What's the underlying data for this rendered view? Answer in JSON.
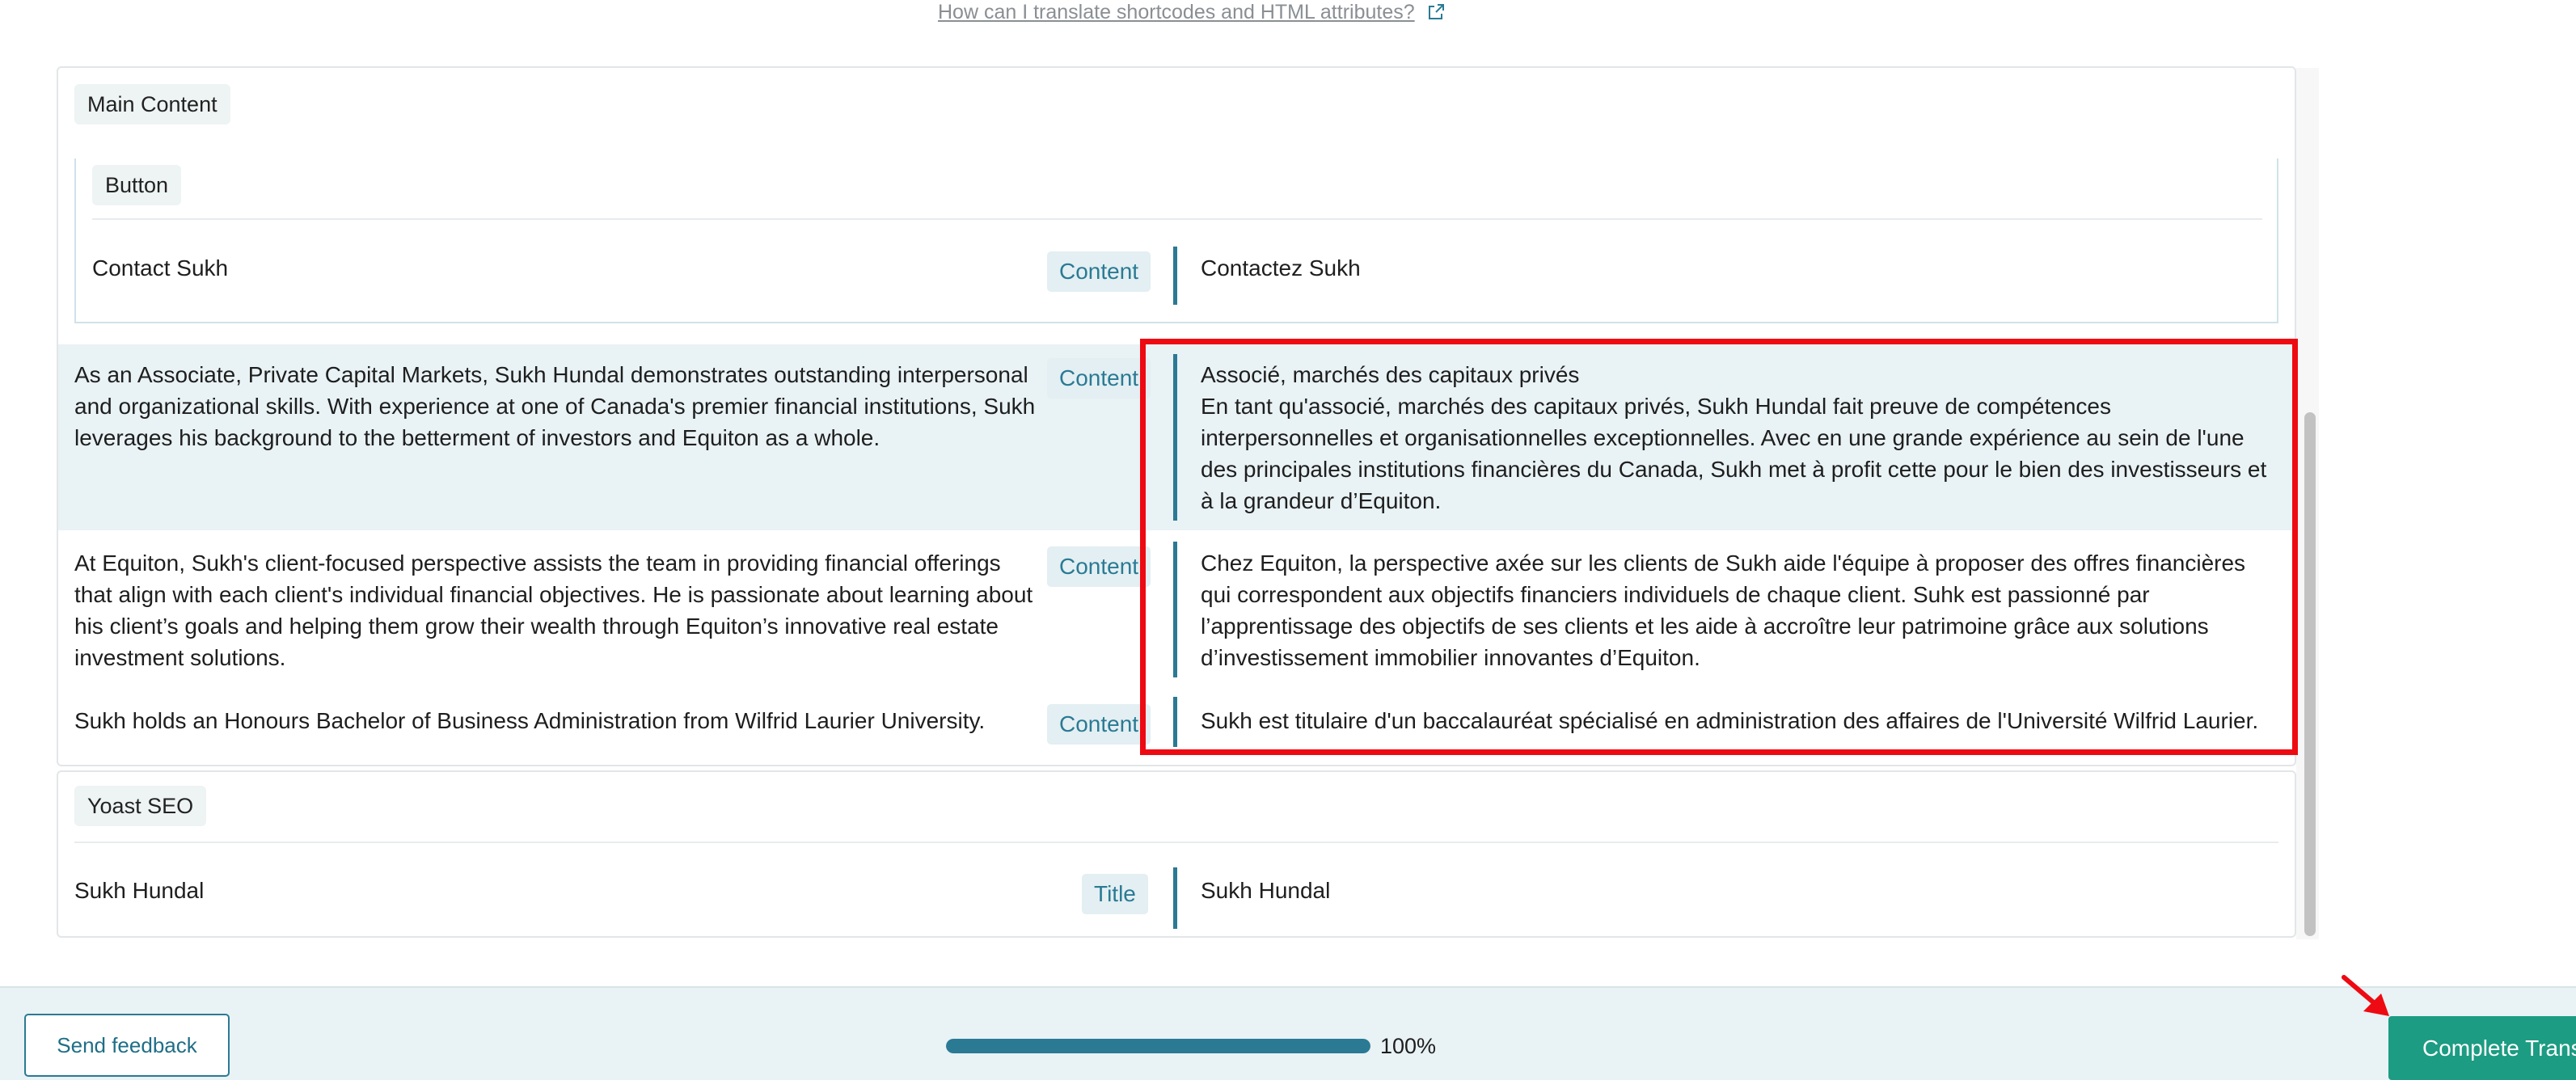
{
  "help": {
    "link_text": "How can I translate shortcodes and HTML attributes?"
  },
  "main_content": {
    "title": "Main Content",
    "button_group": {
      "title": "Button",
      "source": "Contact Sukh",
      "badge": "Content",
      "translation": "Contactez Sukh"
    },
    "rows": [
      {
        "source": "As an Associate, Private Capital Markets, Sukh Hundal demonstrates outstanding interpersonal and organizational skills. With experience at one of Canada's premier financial institutions, Sukh leverages his background to the betterment of investors and Equiton as a whole.",
        "badge": "Content",
        "translation_line1": "Associé, marchés des capitaux privés",
        "translation": "En tant qu'associé, marchés des capitaux privés, Sukh Hundal fait preuve de compétences interpersonnelles et organisationnelles exceptionnelles. Avec en une grande expérience au sein de l'une des principales institutions financières du Canada, Sukh met à profit cette pour le bien des investisseurs et à la grandeur d’Equiton."
      },
      {
        "source": "At Equiton, Sukh's client-focused perspective assists the team in providing financial offerings that align with each client's individual financial objectives. He is passionate about learning about his client’s goals and helping them grow their wealth through Equiton’s innovative real estate investment solutions.",
        "badge": "Content",
        "translation": "Chez Equiton, la perspective axée sur les clients de Sukh aide l'équipe à proposer des offres financières qui correspondent aux objectifs financiers individuels de chaque client. Suhk est passionné par l’apprentissage des objectifs de ses clients et les aide à accroître leur patrimoine grâce aux solutions d’investissement immobilier innovantes d’Equiton."
      },
      {
        "source": "Sukh holds an Honours Bachelor of Business Administration from Wilfrid Laurier University.",
        "badge": "Content",
        "translation": "Sukh est titulaire d'un baccalauréat spécialisé en administration des affaires de l'Université Wilfrid Laurier."
      }
    ]
  },
  "yoast": {
    "title": "Yoast SEO",
    "source": "Sukh Hundal",
    "badge": "Title",
    "translation": "Sukh Hundal"
  },
  "footer": {
    "feedback_label": "Send feedback",
    "progress_percent": 100,
    "progress_label": "100%",
    "complete_label": "Complete Translation"
  },
  "colors": {
    "accent": "#2a7a94",
    "complete_button": "#1c9c82",
    "highlight_row": "#e9f2f4",
    "annotation_red": "#ee0a12"
  }
}
